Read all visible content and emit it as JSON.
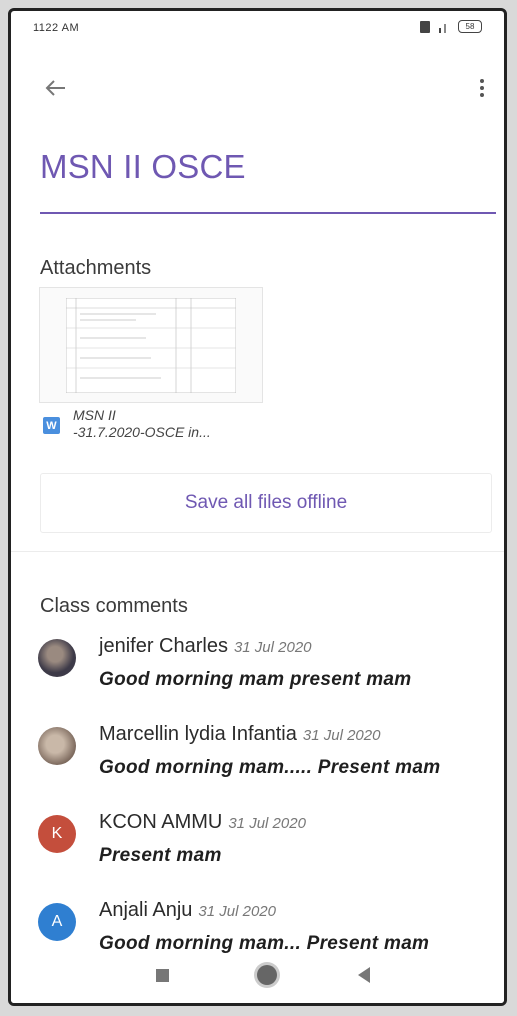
{
  "status_bar": {
    "time": "1122 AM",
    "battery": "58"
  },
  "page": {
    "title": "MSN II OSCE"
  },
  "attachments": {
    "label": "Attachments",
    "file_icon_letter": "W",
    "file_name_line1": "MSN II",
    "file_name_line2": "-31.7.2020-OSCE in...",
    "save_offline_label": "Save all files offline"
  },
  "comments": {
    "label": "Class comments",
    "items": [
      {
        "author": "jenifer Charles",
        "date": "31 Jul 2020",
        "text": "Good morning mam present mam",
        "avatar_letter": ""
      },
      {
        "author": "Marcellin lydia Infantia",
        "date": "31 Jul 2020",
        "text": "Good morning mam..... Present mam",
        "avatar_letter": ""
      },
      {
        "author": "KCON AMMU",
        "date": "31 Jul 2020",
        "text": "Present mam",
        "avatar_letter": "K"
      },
      {
        "author": "Anjali Anju",
        "date": "31 Jul 2020",
        "text": "Good morning mam... Present mam",
        "avatar_letter": "A"
      }
    ]
  },
  "colors": {
    "accent": "#6f58b2",
    "avatar_k": "#c44e3c",
    "avatar_a": "#2f7fd1"
  }
}
